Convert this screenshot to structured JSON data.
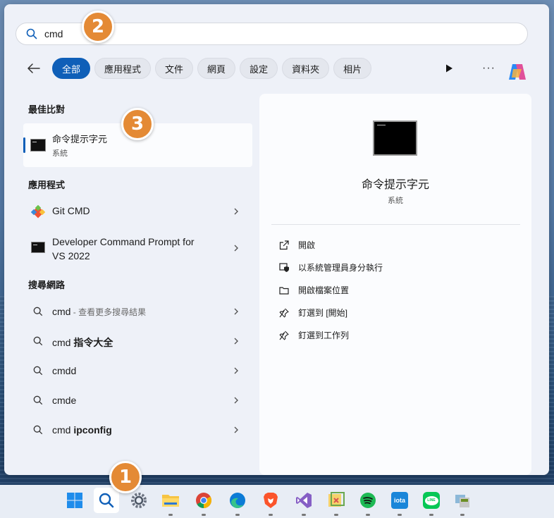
{
  "search": {
    "value": "cmd",
    "placeholder": ""
  },
  "badges": [
    "1",
    "2",
    "3"
  ],
  "filters": [
    "全部",
    "應用程式",
    "文件",
    "網頁",
    "設定",
    "資料夾",
    "相片"
  ],
  "best_match": {
    "section_title": "最佳比對",
    "title": "命令提示字元",
    "subtitle": "系統"
  },
  "apps": {
    "section_title": "應用程式",
    "items": [
      {
        "label": "Git CMD",
        "icon": "git-icon"
      },
      {
        "label_line1": "Developer Command Prompt for",
        "label_line2": "VS 2022",
        "icon": "terminal-icon"
      }
    ]
  },
  "web": {
    "section_title": "搜尋網路",
    "items": [
      {
        "main": "cmd",
        "suffix": " - 查看更多搜尋結果"
      },
      {
        "main": "cmd ",
        "bold": "指令大全"
      },
      {
        "main": "cmdd",
        "bold": ""
      },
      {
        "main": "cmde",
        "bold": ""
      },
      {
        "main": "cmd ",
        "bold": "ipconfig"
      }
    ]
  },
  "preview": {
    "title": "命令提示字元",
    "subtitle": "系統",
    "actions": [
      {
        "label": "開啟",
        "icon": "open-external-icon"
      },
      {
        "label": "以系統管理員身分執行",
        "icon": "shield-icon"
      },
      {
        "label": "開啟檔案位置",
        "icon": "folder-icon"
      },
      {
        "label": "釘選到 [開始]",
        "icon": "pin-icon"
      },
      {
        "label": "釘選到工作列",
        "icon": "pin-icon"
      }
    ]
  },
  "taskbar": {
    "icons": [
      "windows-start-icon",
      "search-icon",
      "settings-icon",
      "file-explorer-icon",
      "chrome-icon",
      "edge-icon",
      "brave-icon",
      "visual-studio-icon",
      "app-icon",
      "spotify-icon",
      "iota-icon",
      "line-icon",
      "app-installer-icon"
    ],
    "iota_label": "iota",
    "line_label": "LINE"
  },
  "colors": {
    "accent": "#0f5fb8",
    "badge": "#e48a35"
  }
}
